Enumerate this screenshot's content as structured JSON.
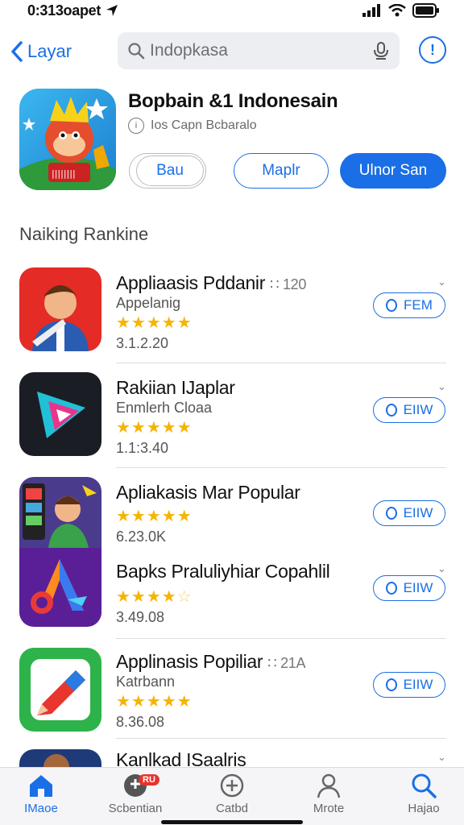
{
  "status": {
    "time": "0:313oapet"
  },
  "top": {
    "back_label": "Layar",
    "search_text": "Indopkasa"
  },
  "featured": {
    "title": "Bopbain &1 Indonesain",
    "subtitle": "Ios Capn Bcbaralo",
    "btn1": "Bau",
    "btn2": "Maplr",
    "btn3": "Ulnor San"
  },
  "section": {
    "title": "Naiking Rankine"
  },
  "apps": [
    {
      "name": "Appliaasis Pddanir",
      "rank": "∷ 120",
      "category": "Appelanig",
      "rating": 5,
      "size": "3.1.2.20",
      "get": "FEM"
    },
    {
      "name": "Rakiian IJaplar",
      "rank": "",
      "category": "Enmlerh Cloaa",
      "rating": 5,
      "size": "1.1:3.40",
      "get": "EIIW"
    },
    {
      "name": "Apliakasis Mar Popular",
      "rank": "",
      "category": "",
      "rating": 5,
      "size": "6.23.0K",
      "get": "EIIW"
    },
    {
      "name": "Bapks Praluliyhiar Copahlil",
      "rank": "",
      "category": "",
      "rating": 4,
      "size": "3.49.08",
      "get": "EIIW"
    },
    {
      "name": "Applinasis Popiliar",
      "rank": "∷ 21A",
      "category": "Katrbann",
      "rating": 5,
      "size": "8.36.08",
      "get": "EIIW"
    },
    {
      "name": "Kanlkad ISaalris",
      "rank": "",
      "category": "",
      "rating": 0,
      "size": "",
      "get": ""
    }
  ],
  "tabs": [
    {
      "label": "IMaoe",
      "icon": "home-icon",
      "active": true
    },
    {
      "label": "Scbentian",
      "icon": "games-icon",
      "badge": "RU"
    },
    {
      "label": "Catbd",
      "icon": "compass-icon"
    },
    {
      "label": "Mrote",
      "icon": "person-icon"
    },
    {
      "label": "Hajao",
      "icon": "search-icon"
    }
  ],
  "colors": {
    "accent": "#1a6fe6",
    "star": "#f6b400",
    "badge": "#e8332e"
  }
}
